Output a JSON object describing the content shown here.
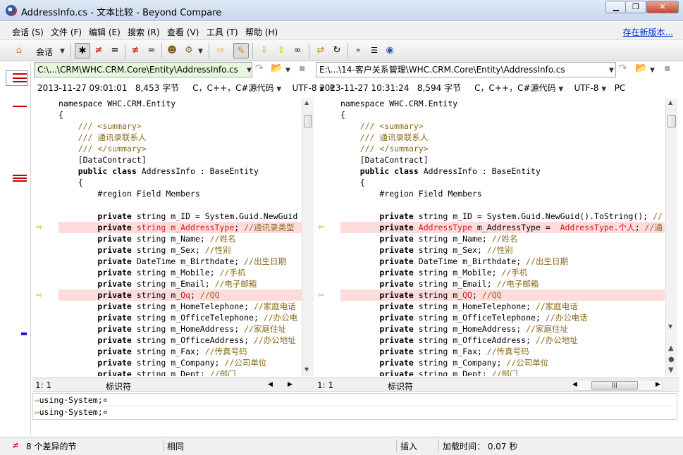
{
  "window": {
    "title": "AddressInfo.cs - 文本比较 - Beyond Compare"
  },
  "menu": {
    "items": [
      "会话 (S)",
      "文件 (F)",
      "编辑 (E)",
      "搜索 (R)",
      "查看 (V)",
      "工具 (T)",
      "帮助 (H)"
    ],
    "new_version": "存在新版本..."
  },
  "toolbar": {
    "session_label": "会话"
  },
  "left": {
    "path": "C:\\...\\CRM\\WHC.CRM.Core\\Entity\\AddressInfo.cs",
    "timestamp": "2013-11-27 09:01:01",
    "size": "8,453 字节",
    "format": "C，C++，C#源代码",
    "encoding": "UTF-8",
    "lineend": "P",
    "position": "1: 1",
    "ident": "标识符"
  },
  "right": {
    "path": "E:\\...\\14-客户关系管理\\WHC.CRM.Core\\Entity\\AddressInfo.cs",
    "timestamp": "2013-11-27 10:31:24",
    "size": "8,594 字节",
    "format": "C，C++，C#源代码",
    "encoding": "UTF-8",
    "lineend": "PC",
    "position": "1: 1",
    "ident": "标识符"
  },
  "left_code": [
    "namespace WHC.CRM.Entity",
    "{",
    "    /// <summary>",
    "    /// 通讯录联系人",
    "    /// </summary>",
    "    [DataContract]",
    "    public class AddressInfo : BaseEntity",
    "    {",
    "        #region Field Members",
    "",
    "        private string m_ID = System.Guid.NewGuid",
    "        private string m_AddressType; //通讯录类型",
    "        private string m_Name; //姓名",
    "        private string m_Sex; //性别",
    "        private DateTime m_Birthdate; //出生日期",
    "        private string m_Mobile; //手机",
    "        private string m_Email; //电子邮箱",
    "        private string m_Qq; //QQ",
    "        private string m_HomeTelephone; //家庭电话",
    "        private string m_OfficeTelephone; //办公电",
    "        private string m_HomeAddress; //家庭住址",
    "        private string m_OfficeAddress; //办公地址",
    "        private string m_Fax; //传真号码",
    "        private string m_Company; //公司单位",
    "        private string m_Dept; //部门"
  ],
  "right_code": [
    "namespace WHC.CRM.Entity",
    "{",
    "    /// <summary>",
    "    /// 通讯录联系人",
    "    /// </summary>",
    "    [DataContract]",
    "    public class AddressInfo : BaseEntity",
    "    {",
    "        #region Field Members",
    "",
    "        private string m_ID = System.Guid.NewGuid().ToString(); //",
    "        private AddressType m_AddressType =  AddressType.个人; //通",
    "        private string m_Name; //姓名",
    "        private string m_Sex; //性别",
    "        private DateTime m_Birthdate; //出生日期",
    "        private string m_Mobile; //手机",
    "        private string m_Email; //电子邮箱",
    "        private string m_QQ; //QQ",
    "        private string m_HomeTelephone; //家庭电话",
    "        private string m_OfficeTelephone; //办公电话",
    "        private string m_HomeAddress; //家庭住址",
    "        private string m_OfficeAddress; //办公地址",
    "        private string m_Fax; //传真号码",
    "        private string m_Company; //公司单位",
    "        private string m_Dept; //部门"
  ],
  "detail": {
    "top": "using·System;¤",
    "bottom": "using·System;¤"
  },
  "status": {
    "diff_count": "8 个差异的节",
    "same": "相同",
    "insert": "插入",
    "load_time": "加载时间： 0.07 秒"
  },
  "colors": {
    "diff_bg": "#ffdcdc",
    "left_path_bg": "#e7f7dd",
    "diff_red": "#d01818"
  }
}
